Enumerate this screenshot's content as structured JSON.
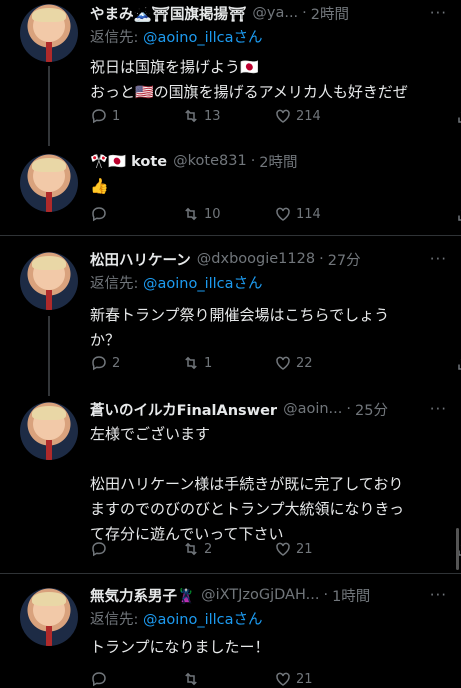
{
  "tweets": [
    {
      "name": "やまみ🗻⛩国旗掲揚⛩",
      "handle": "@ya...",
      "time": "2時間",
      "reply_prefix": "返信先: ",
      "reply_to": "@aoino_illcaさん",
      "body_lines": [
        "祝日は国旗を揚げよう🇯🇵",
        "おっと🇺🇸の国旗を揚げるアメリカ人も好きだぜ"
      ],
      "replies": "1",
      "retweets": "13",
      "likes": "214"
    },
    {
      "name": "🎌🇯🇵 kote",
      "handle": "@kote831",
      "time": "2時間",
      "body_lines": [
        "👍"
      ],
      "replies": "",
      "retweets": "10",
      "likes": "114"
    },
    {
      "name": "松田ハリケーン",
      "handle": "@dxboogie1128",
      "time": "27分",
      "reply_prefix": "返信先: ",
      "reply_to": "@aoino_illcaさん",
      "body_lines": [
        "新春トランプ祭り開催会場はこちらでしょう",
        "か？"
      ],
      "replies": "2",
      "retweets": "1",
      "likes": "22"
    },
    {
      "name": "蒼いのイルカFinalAnswer",
      "handle": "@aoin...",
      "time": "25分",
      "body_lines": [
        "左様でございます",
        "",
        "松田ハリケーン様は手続きが既に完了しており",
        "ますのでのびのびとトランプ大統領になりきっ",
        "て存分に遊んでいって下さい"
      ],
      "replies": "",
      "retweets": "2",
      "likes": "21"
    },
    {
      "name": "無気力系男子🦹",
      "handle": "@iXTJzoGjDAH...",
      "time": "1時間",
      "reply_prefix": "返信先: ",
      "reply_to": "@aoino_illcaさん",
      "body_lines": [
        "トランプになりましたー！"
      ],
      "replies": "",
      "retweets": "",
      "likes": "21"
    }
  ]
}
